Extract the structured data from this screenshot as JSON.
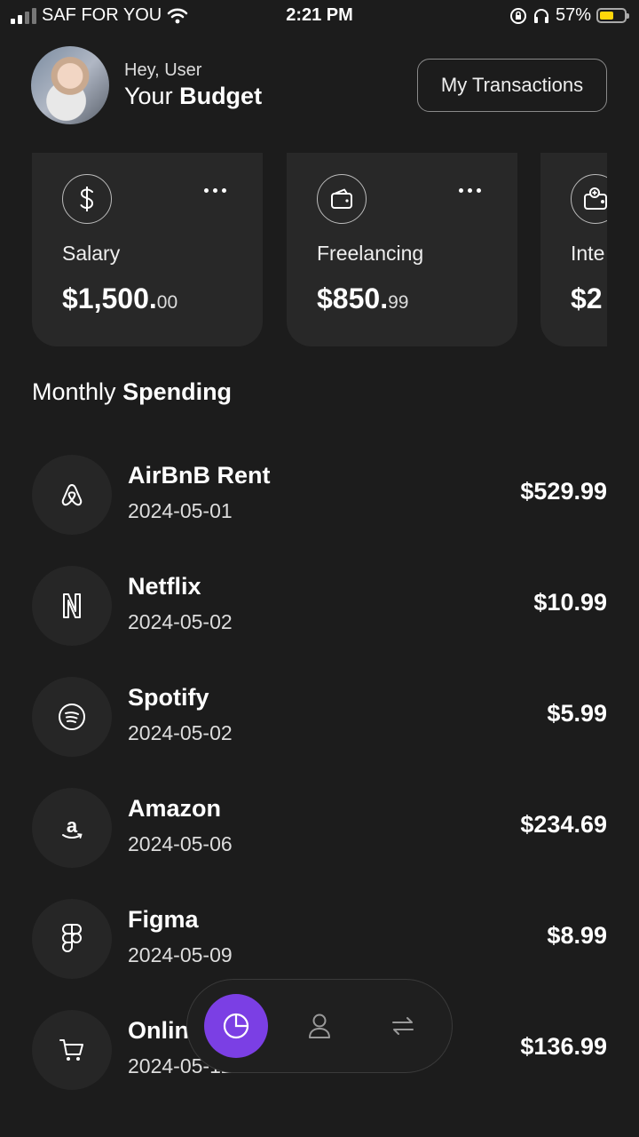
{
  "status_bar": {
    "carrier": "SAF FOR YOU",
    "time": "2:21 PM",
    "battery_percent": "57%",
    "battery_level": 0.57,
    "battery_color": "#ffd60a"
  },
  "header": {
    "greeting": "Hey, User",
    "title_prefix": "Your",
    "title_bold": "Budget",
    "transactions_button": "My Transactions"
  },
  "income_cards": [
    {
      "icon": "dollar-icon",
      "name": "Salary",
      "amount_main": "$1,500.",
      "amount_cents": "00"
    },
    {
      "icon": "wallet-icon",
      "name": "Freelancing",
      "amount_main": "$850.",
      "amount_cents": "99"
    },
    {
      "icon": "wallet-plus-icon",
      "name": "Inte",
      "amount_main": "$2",
      "amount_cents": ""
    }
  ],
  "spending": {
    "title_prefix": "Monthly",
    "title_bold": "Spending",
    "items": [
      {
        "icon": "airbnb-icon",
        "name": "AirBnB Rent",
        "date": "2024-05-01",
        "amount": "$529.99"
      },
      {
        "icon": "netflix-icon",
        "name": "Netflix",
        "date": "2024-05-02",
        "amount": "$10.99"
      },
      {
        "icon": "spotify-icon",
        "name": "Spotify",
        "date": "2024-05-02",
        "amount": "$5.99"
      },
      {
        "icon": "amazon-icon",
        "name": "Amazon",
        "date": "2024-05-06",
        "amount": "$234.69"
      },
      {
        "icon": "figma-icon",
        "name": "Figma",
        "date": "2024-05-09",
        "amount": "$8.99"
      },
      {
        "icon": "cart-icon",
        "name": "Onlin",
        "date": "2024-05-12",
        "amount": "$136.99"
      }
    ]
  },
  "nav": {
    "accent_color": "#7b3fe4",
    "items": [
      "pie-chart-icon",
      "user-icon",
      "transfer-icon"
    ]
  }
}
